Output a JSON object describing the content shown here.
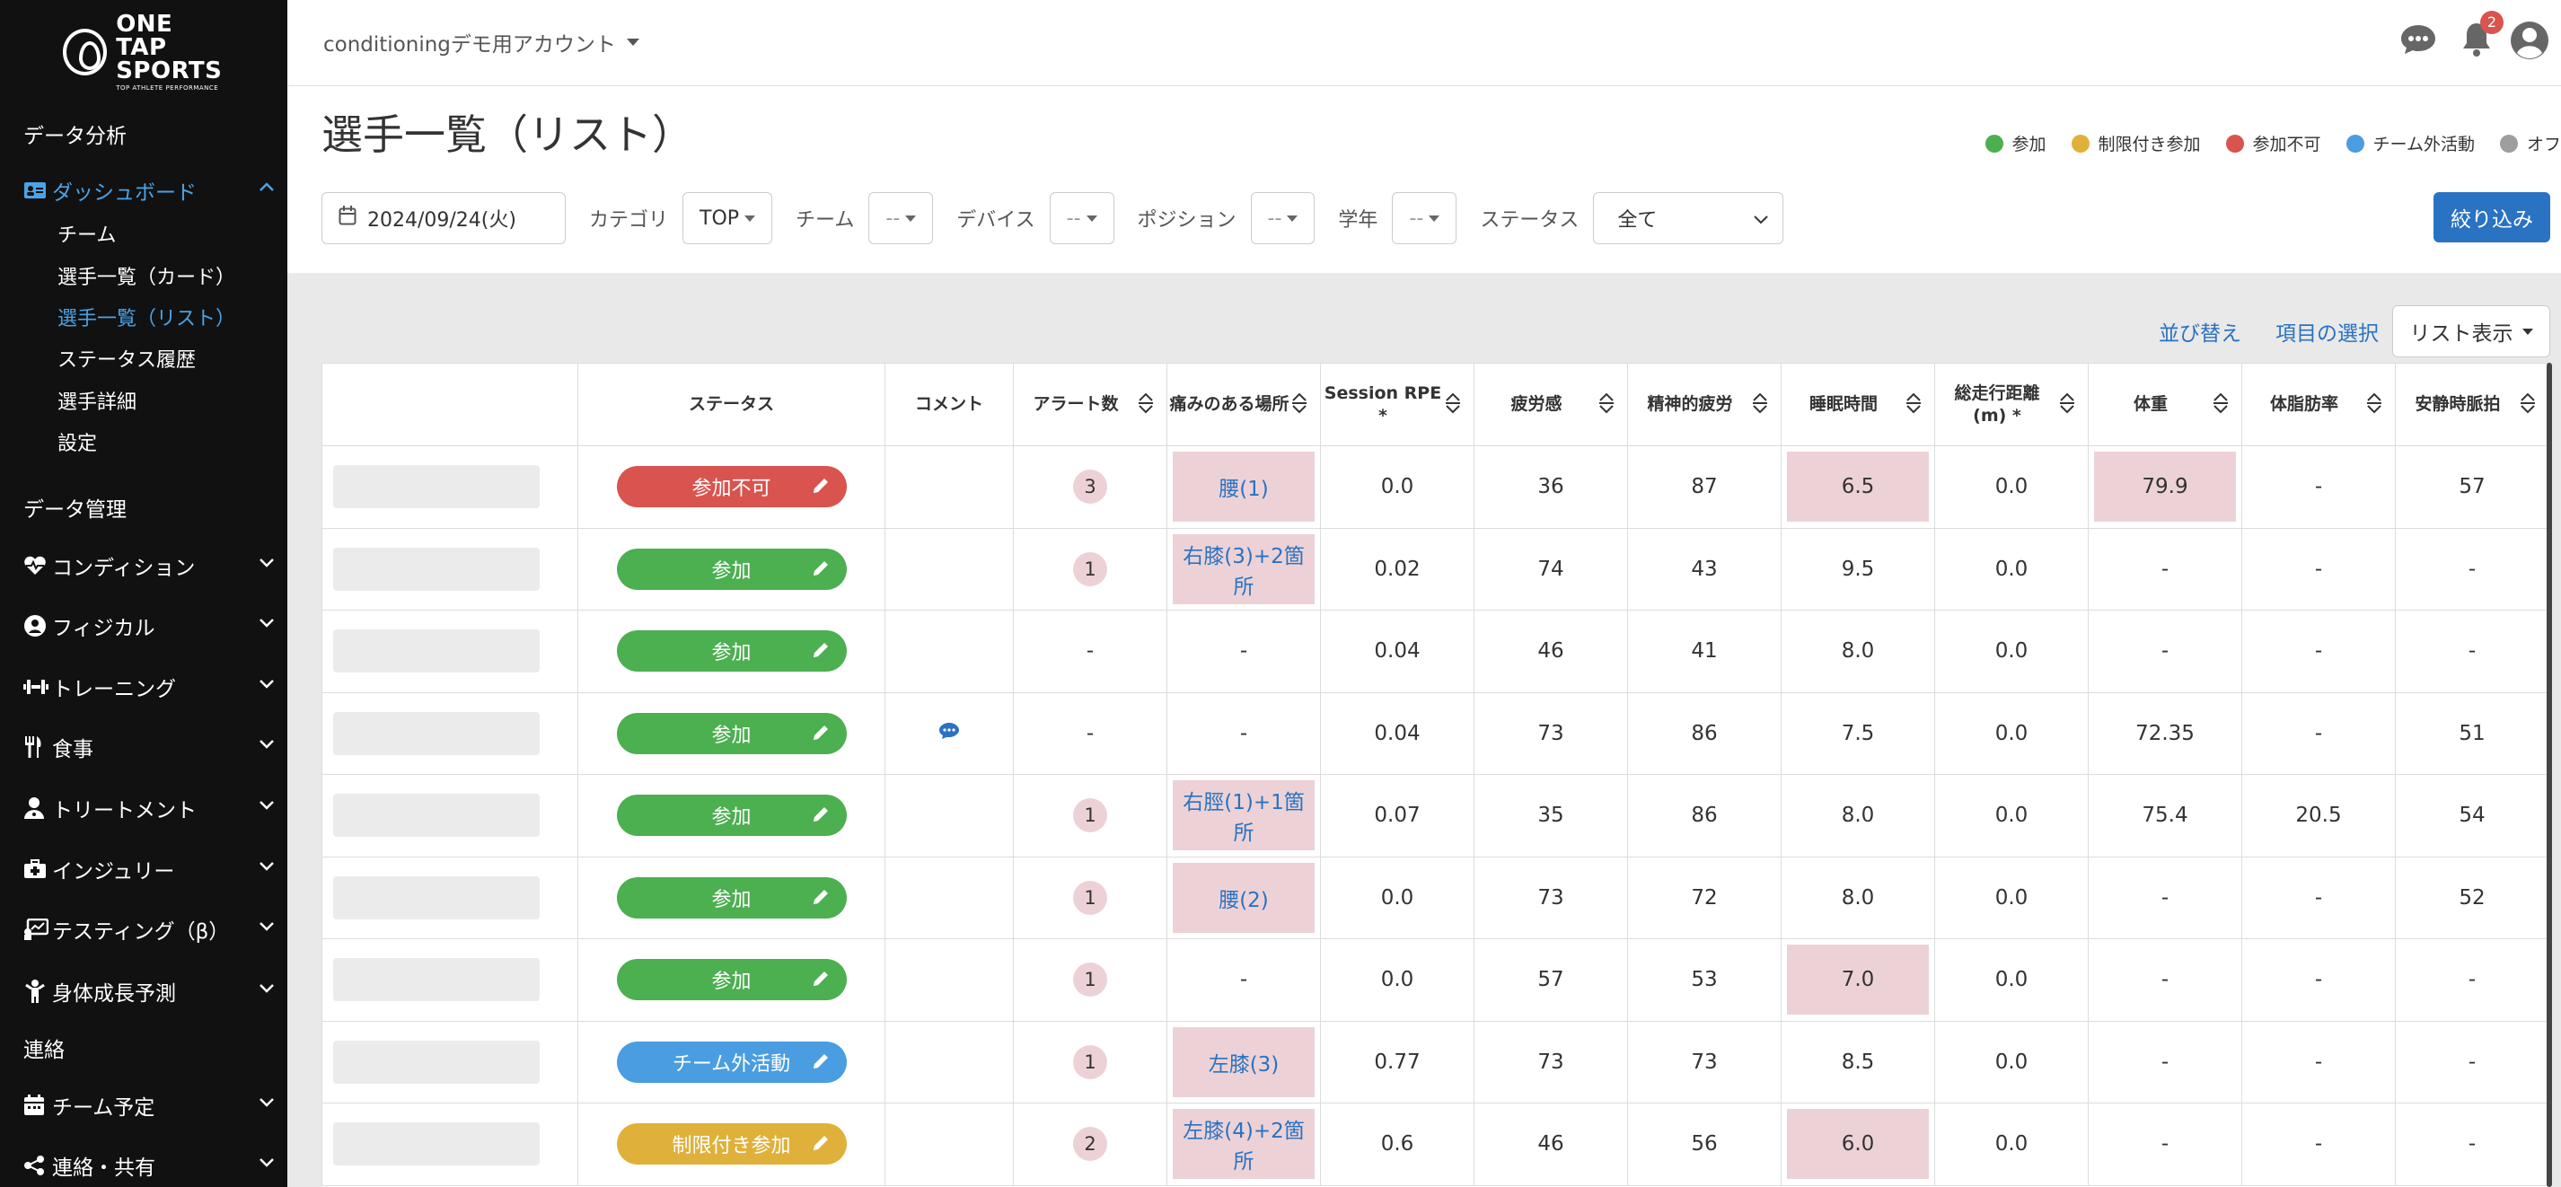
{
  "brand": {
    "line1": "ONE TAP",
    "line2": "SPORTS",
    "tagline": "TOP ATHLETE PERFORMANCE"
  },
  "sidebar": {
    "section_analysis": "データ分析",
    "dashboard": "ダッシュボード",
    "dashboard_items": [
      "チーム",
      "選手一覧（カード）",
      "選手一覧（リスト）",
      "ステータス履歴",
      "選手詳細",
      "設定"
    ],
    "section_management": "データ管理",
    "management_items": [
      "コンディション",
      "フィジカル",
      "トレーニング",
      "食事",
      "トリートメント",
      "インジュリー",
      "テスティング（β）",
      "身体成長予測"
    ],
    "section_contact": "連絡",
    "contact_items": [
      "チーム予定",
      "連絡・共有"
    ]
  },
  "topbar": {
    "account": "conditioningデモ用アカウント",
    "notification_count": "2"
  },
  "page": {
    "title": "選手一覧（リスト）"
  },
  "legend": [
    {
      "label": "参加",
      "color": "#4caf50"
    },
    {
      "label": "制限付き参加",
      "color": "#e0b13a"
    },
    {
      "label": "参加不可",
      "color": "#d9534f"
    },
    {
      "label": "チーム外活動",
      "color": "#4a9de0"
    },
    {
      "label": "オフ",
      "color": "#9e9e9e"
    }
  ],
  "filters": {
    "date": "2024/09/24(火)",
    "category_label": "カテゴリ",
    "category_value": "TOP",
    "team_label": "チーム",
    "team_value": "--",
    "device_label": "デバイス",
    "device_value": "--",
    "position_label": "ポジション",
    "position_value": "--",
    "grade_label": "学年",
    "grade_value": "--",
    "status_label": "ステータス",
    "status_value": "全て",
    "apply": "絞り込み"
  },
  "toolbar": {
    "sort": "並び替え",
    "select_items": "項目の選択",
    "view": "リスト表示"
  },
  "table": {
    "headers": [
      "ステータス",
      "コメント",
      "アラート数",
      "痛みのある場所",
      "Session RPE *",
      "疲労感",
      "精神的疲労",
      "睡眠時間",
      "総走行距離 (m) *",
      "体重",
      "体脂肪率",
      "安静時脈拍"
    ],
    "rows": [
      {
        "status": "参加不可",
        "color": "#d9534f",
        "comment": "",
        "alerts": "3",
        "pain": "腰(1)",
        "rpe": "0.0",
        "fatigue": "36",
        "mental": "87",
        "sleep": "6.5",
        "sleep_hl": true,
        "distance": "0.0",
        "weight": "79.9",
        "weight_hl": true,
        "bodyfat": "-",
        "pulse": "57"
      },
      {
        "status": "参加",
        "color": "#4caf50",
        "comment": "",
        "alerts": "1",
        "pain": "右膝(3)+2箇所",
        "rpe": "0.02",
        "fatigue": "74",
        "mental": "43",
        "sleep": "9.5",
        "sleep_hl": false,
        "distance": "0.0",
        "weight": "-",
        "weight_hl": false,
        "bodyfat": "-",
        "pulse": "-"
      },
      {
        "status": "参加",
        "color": "#4caf50",
        "comment": "",
        "alerts": "-",
        "pain": "-",
        "rpe": "0.04",
        "fatigue": "46",
        "mental": "41",
        "sleep": "8.0",
        "sleep_hl": false,
        "distance": "0.0",
        "weight": "-",
        "weight_hl": false,
        "bodyfat": "-",
        "pulse": "-"
      },
      {
        "status": "参加",
        "color": "#4caf50",
        "comment": "chat",
        "alerts": "-",
        "pain": "-",
        "rpe": "0.04",
        "fatigue": "73",
        "mental": "86",
        "sleep": "7.5",
        "sleep_hl": false,
        "distance": "0.0",
        "weight": "72.35",
        "weight_hl": false,
        "bodyfat": "-",
        "pulse": "51"
      },
      {
        "status": "参加",
        "color": "#4caf50",
        "comment": "",
        "alerts": "1",
        "pain": "右脛(1)+1箇所",
        "rpe": "0.07",
        "fatigue": "35",
        "mental": "86",
        "sleep": "8.0",
        "sleep_hl": false,
        "distance": "0.0",
        "weight": "75.4",
        "weight_hl": false,
        "bodyfat": "20.5",
        "pulse": "54"
      },
      {
        "status": "参加",
        "color": "#4caf50",
        "comment": "",
        "alerts": "1",
        "pain": "腰(2)",
        "rpe": "0.0",
        "fatigue": "73",
        "mental": "72",
        "sleep": "8.0",
        "sleep_hl": false,
        "distance": "0.0",
        "weight": "-",
        "weight_hl": false,
        "bodyfat": "-",
        "pulse": "52"
      },
      {
        "status": "参加",
        "color": "#4caf50",
        "comment": "",
        "alerts": "1",
        "pain": "-",
        "rpe": "0.0",
        "fatigue": "57",
        "mental": "53",
        "sleep": "7.0",
        "sleep_hl": true,
        "distance": "0.0",
        "weight": "-",
        "weight_hl": false,
        "bodyfat": "-",
        "pulse": "-"
      },
      {
        "status": "チーム外活動",
        "color": "#4a9de0",
        "comment": "",
        "alerts": "1",
        "pain": "左膝(3)",
        "rpe": "0.77",
        "fatigue": "73",
        "mental": "73",
        "sleep": "8.5",
        "sleep_hl": false,
        "distance": "0.0",
        "weight": "-",
        "weight_hl": false,
        "bodyfat": "-",
        "pulse": "-"
      },
      {
        "status": "制限付き参加",
        "color": "#e0b13a",
        "comment": "",
        "alerts": "2",
        "pain": "左膝(4)+2箇所",
        "rpe": "0.6",
        "fatigue": "46",
        "mental": "56",
        "sleep": "6.0",
        "sleep_hl": true,
        "distance": "0.0",
        "weight": "-",
        "weight_hl": false,
        "bodyfat": "-",
        "pulse": "-"
      }
    ]
  }
}
